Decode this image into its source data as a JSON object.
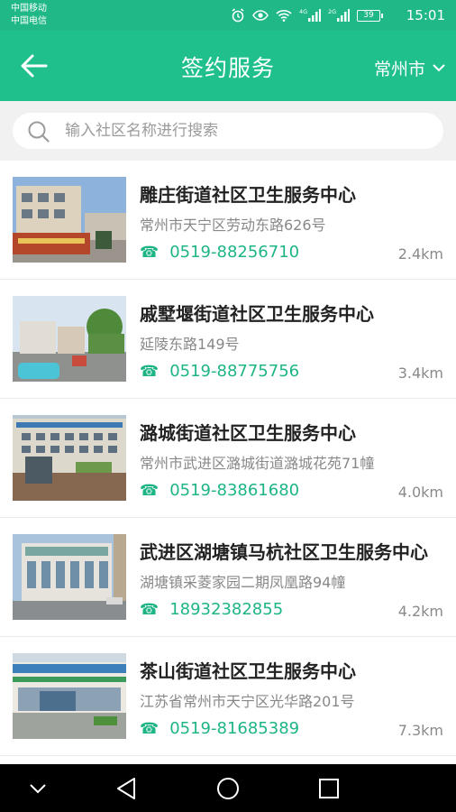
{
  "status": {
    "carrier1": "中国移动",
    "carrier2": "中国电信",
    "net1": "4G",
    "net2": "2G",
    "battery": "39",
    "time": "15:01"
  },
  "header": {
    "title": "签约服务",
    "city": "常州市",
    "accent_color": "#20c08d"
  },
  "search": {
    "placeholder": "输入社区名称进行搜索",
    "value": ""
  },
  "items": [
    {
      "name": "雕庄街道社区卫生服务中心",
      "address": "常州市天宁区劳动东路626号",
      "phone": "0519-88256710",
      "distance": "2.4km"
    },
    {
      "name": "戚墅堰街道社区卫生服务中心",
      "address": "延陵东路149号",
      "phone": "0519-88775756",
      "distance": "3.4km"
    },
    {
      "name": "潞城街道社区卫生服务中心",
      "address": "常州市武进区潞城街道潞城花苑71幢",
      "phone": "0519-83861680",
      "distance": "4.0km"
    },
    {
      "name": "武进区湖塘镇马杭社区卫生服务中心",
      "address": "湖塘镇采菱家园二期凤凰路94幢",
      "phone": "18932382855",
      "distance": "4.2km"
    },
    {
      "name": "茶山街道社区卫生服务中心",
      "address": "江苏省常州市天宁区光华路201号",
      "phone": "0519-81685389",
      "distance": "7.3km"
    }
  ],
  "icons": {
    "phone": "☎",
    "back": "arrow-left-icon",
    "dropdown": "chevron-down-icon",
    "search": "search-icon"
  }
}
